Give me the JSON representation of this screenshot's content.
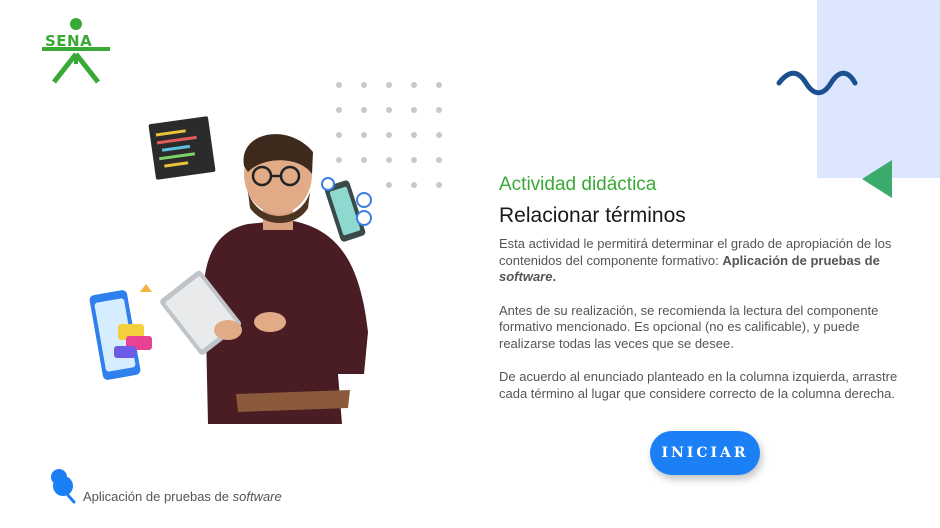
{
  "brand": {
    "logo_text": "SENA",
    "accent_green": "#39a935",
    "accent_blue": "#1b7ff5",
    "panel_blue": "#dce6ff"
  },
  "content": {
    "eyebrow": "Actividad didáctica",
    "title": "Relacionar términos",
    "p1_start": "Esta actividad le permitirá determinar el grado de apropiación de los contenidos del componente formativo: ",
    "p1_bold": "Aplicación de pruebas de ",
    "p1_bold_italic": "software",
    "p1_end": ".",
    "p2": "Antes de su realización, se recomienda la lectura del componente formativo mencionado.  Es opcional (no es calificable), y puede realizarse todas las veces que se desee.",
    "p3": "De acuerdo al enunciado planteado en la columna izquierda, arrastre cada término al lugar que considere correcto de la columna derecha."
  },
  "start_button": {
    "label": "INICIAR"
  },
  "footer": {
    "course_name": "Aplicación de pruebas de ",
    "course_name_italic": "software"
  },
  "icons": [
    "sena-logo",
    "wave-icon",
    "triangle-icon",
    "dot-grid",
    "man-tablet-illustration",
    "pushpin-icon"
  ]
}
